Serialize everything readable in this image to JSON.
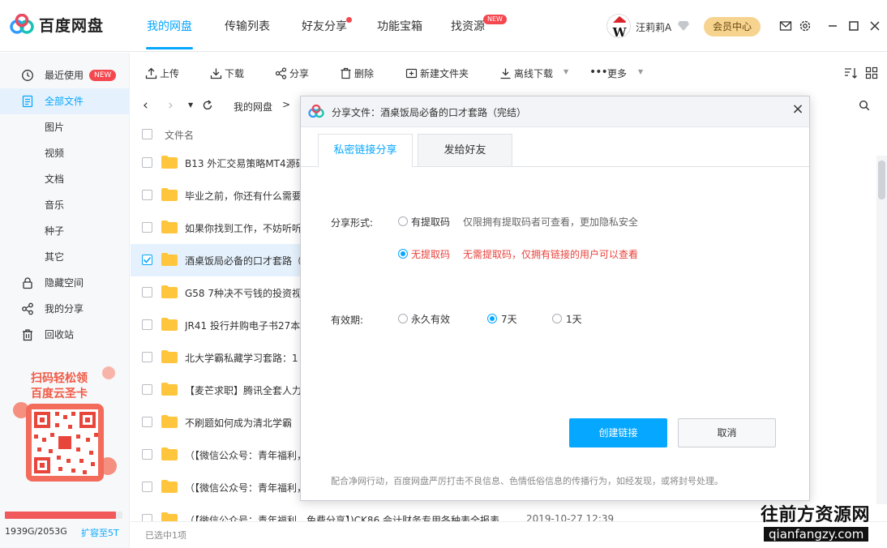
{
  "app": {
    "title": "百度网盘"
  },
  "nav": {
    "tabs": [
      {
        "label": "我的网盘"
      },
      {
        "label": "传输列表"
      },
      {
        "label": "好友分享"
      },
      {
        "label": "功能宝箱"
      },
      {
        "label": "找资源",
        "badge": "NEW"
      }
    ]
  },
  "user": {
    "name": "汪莉莉A",
    "vip_label": "会员中心"
  },
  "sidebar": {
    "items": [
      {
        "label": "最近使用",
        "badge": "NEW",
        "icon": "clock-icon"
      },
      {
        "label": "全部文件",
        "icon": "document-icon"
      },
      {
        "label": "图片"
      },
      {
        "label": "视频"
      },
      {
        "label": "文档"
      },
      {
        "label": "音乐"
      },
      {
        "label": "种子"
      },
      {
        "label": "其它"
      },
      {
        "label": "隐藏空间",
        "icon": "lock-icon"
      },
      {
        "label": "我的分享",
        "icon": "share-icon"
      },
      {
        "label": "回收站",
        "icon": "trash-icon"
      }
    ],
    "promo": {
      "line1": "扫码轻松领",
      "line2": "百度云圣卡"
    },
    "storage": {
      "text": "1939G/2053G",
      "used_fraction": 0.944,
      "expand": "扩容至5T"
    }
  },
  "toolbar": {
    "upload": "上传",
    "download": "下载",
    "share": "分享",
    "delete": "删除",
    "new_folder": "新建文件夹",
    "offline": "离线下载",
    "more": "更多"
  },
  "path": {
    "root": "我的网盘"
  },
  "files": {
    "header": "文件名",
    "rows": [
      {
        "name": "B13 外汇交易策略MT4源码",
        "checked": false
      },
      {
        "name": "毕业之前，你还有什么需要",
        "checked": false
      },
      {
        "name": "如果你找到工作，不妨听听",
        "checked": false
      },
      {
        "name": "酒桌饭局必备的口才套路（完结）",
        "checked": true
      },
      {
        "name": "G58 7种决不亏钱的投资视",
        "checked": false
      },
      {
        "name": "JR41 投行并购电子书27本",
        "checked": false
      },
      {
        "name": "北大学霸私藏学习套路：1",
        "checked": false
      },
      {
        "name": "【麦芒求职】腾讯全套人力",
        "checked": false
      },
      {
        "name": "不刷题如何成为清北学霸",
        "checked": false
      },
      {
        "name": "（【微信公众号：青年福利，",
        "checked": false
      },
      {
        "name": "（【微信公众号：青年福利，",
        "checked": false
      },
      {
        "name": "（【微信公众号：青年福利，免费分享】)CK86 会计财务专用各种表全报表",
        "date": "2019-10-27 12:39",
        "checked": false
      }
    ],
    "status": "已选中1项"
  },
  "dialog": {
    "title": "分享文件：酒桌饭局必备的口才套路（完结）",
    "tabs": [
      "私密链接分享",
      "发给好友"
    ],
    "share_form_label": "分享形式:",
    "options": [
      {
        "label": "有提取码",
        "desc": "仅限拥有提取码者可查看，更加隐私安全",
        "selected": false
      },
      {
        "label": "无提取码",
        "desc": "无需提取码，仅拥有链接的用户可以查看",
        "selected": true
      }
    ],
    "validity_label": "有效期:",
    "validity": [
      {
        "label": "永久有效",
        "selected": false
      },
      {
        "label": "7天",
        "selected": true
      },
      {
        "label": "1天",
        "selected": false
      }
    ],
    "create": "创建链接",
    "cancel": "取消",
    "notice": "配合净网行动，百度网盘严厉打击不良信息、色情低俗信息的传播行为，如经发现，或将封号处理。"
  },
  "watermark": {
    "line1": "往前方资源网",
    "line2": "qianfangzy.com"
  },
  "colors": {
    "accent": "#06a7ff",
    "badge": "#f5474f",
    "warning_text": "#e8413b"
  }
}
